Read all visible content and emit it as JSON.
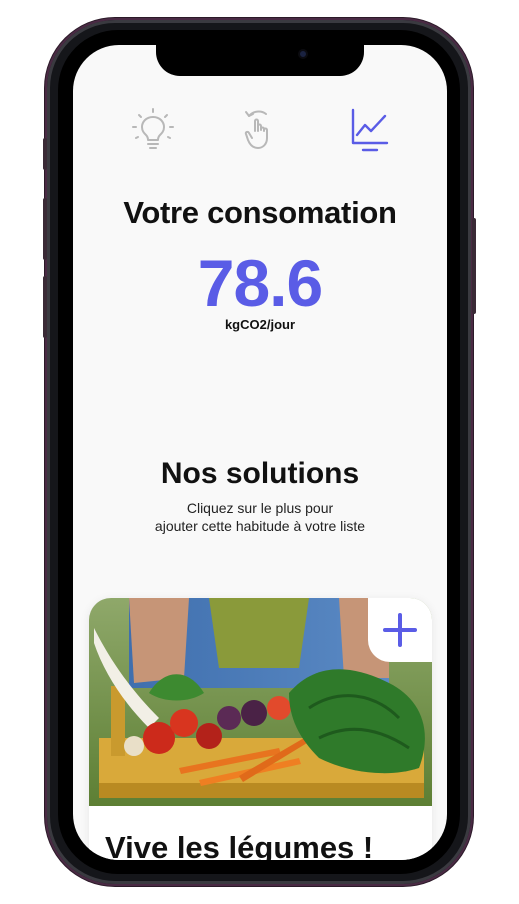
{
  "nav": {
    "icons": [
      "lightbulb-icon",
      "swipe-hand-icon",
      "chart-line-icon"
    ],
    "active": "chart-line-icon"
  },
  "consumption": {
    "title": "Votre consomation",
    "value": "78.6",
    "unit": "kgCO2/jour"
  },
  "solutions": {
    "title": "Nos solutions",
    "subtitle_line1": "Cliquez sur le plus pour",
    "subtitle_line2": "ajouter cette habitude à votre liste"
  },
  "card": {
    "title": "Vive les légumes !",
    "add_label": "+"
  },
  "colors": {
    "accent": "#5a5ce6",
    "icon_inactive": "#b8b8b8",
    "background": "#f9f9f9"
  }
}
